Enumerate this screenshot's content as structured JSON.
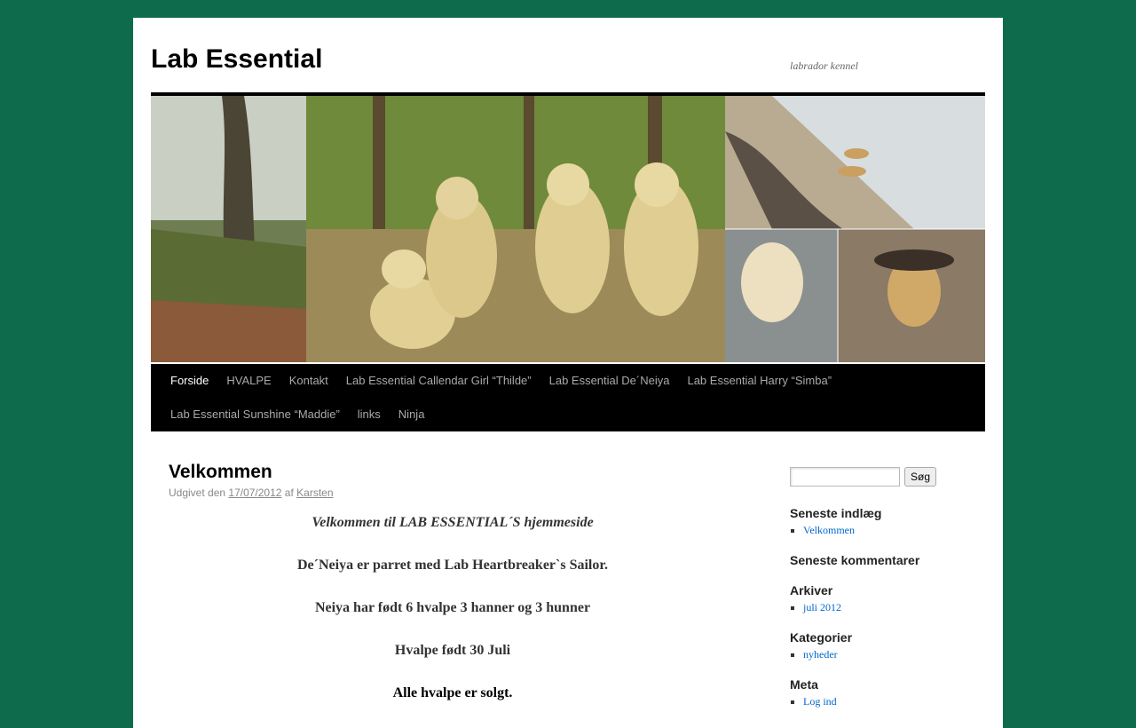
{
  "site": {
    "title": "Lab Essential",
    "description": "labrador kennel"
  },
  "nav": {
    "items": [
      {
        "label": "Forside"
      },
      {
        "label": "HVALPE"
      },
      {
        "label": "Kontakt"
      },
      {
        "label": "Lab Essential Callendar Girl “Thilde”"
      },
      {
        "label": "Lab Essential De´Neiya"
      },
      {
        "label": "Lab Essential Harry “Simba”"
      },
      {
        "label": "Lab Essential Sunshine “Maddie”"
      },
      {
        "label": "links"
      },
      {
        "label": "Ninja"
      }
    ]
  },
  "post": {
    "title": "Velkommen",
    "meta_prefix": "Udgivet den",
    "date": "17/07/2012",
    "meta_by": "af",
    "author": "Karsten",
    "paragraphs": [
      "Velkommen til LAB ESSENTIAL´S hjemmeside",
      "De´Neiya er parret med Lab Heartbreaker`s Sailor.",
      "Neiya har født 6 hvalpe 3 hanner og 3 hunner",
      "Hvalpe født 30 Juli",
      "Alle hvalpe er solgt."
    ]
  },
  "sidebar": {
    "search_button": "Søg",
    "recent_posts": {
      "title": "Seneste indlæg",
      "items": [
        "Velkommen"
      ]
    },
    "recent_comments": {
      "title": "Seneste kommentarer"
    },
    "archives": {
      "title": "Arkiver",
      "items": [
        "juli 2012"
      ]
    },
    "categories": {
      "title": "Kategorier",
      "items": [
        "nyheder"
      ]
    },
    "meta": {
      "title": "Meta",
      "items": [
        "Log ind"
      ]
    }
  },
  "colors": {
    "background": "#0e6b4c",
    "nav_bar": "#000000",
    "link": "#0066cc"
  }
}
